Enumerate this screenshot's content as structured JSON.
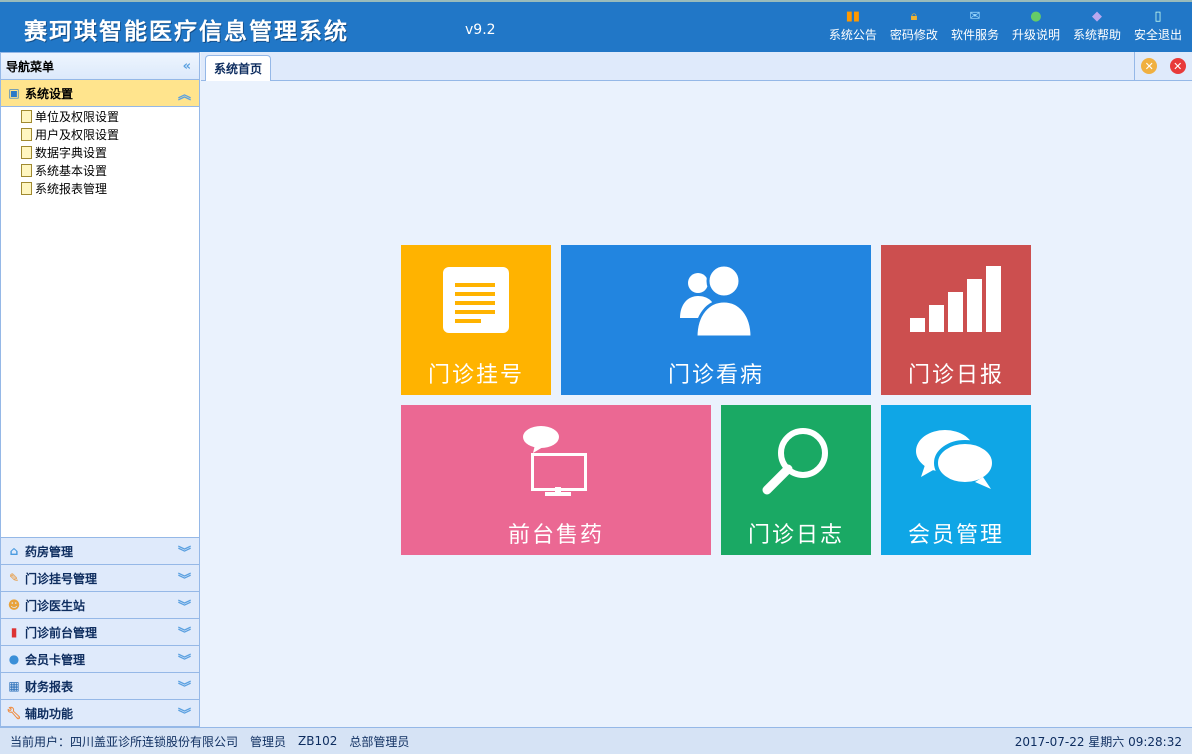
{
  "header": {
    "title": "赛珂琪智能医疗信息管理系统",
    "version": "v9.2",
    "tools": [
      {
        "label": "系统公告",
        "icon": "announcement-icon"
      },
      {
        "label": "密码修改",
        "icon": "lock-icon"
      },
      {
        "label": "软件服务",
        "icon": "mail-icon"
      },
      {
        "label": "升级说明",
        "icon": "globe-icon"
      },
      {
        "label": "系统帮助",
        "icon": "book-icon"
      },
      {
        "label": "安全退出",
        "icon": "exit-door-icon"
      }
    ]
  },
  "sidebar": {
    "title": "导航菜单",
    "active": {
      "label": "系统设置",
      "items": [
        "单位及权限设置",
        "用户及权限设置",
        "数据字典设置",
        "系统基本设置",
        "系统报表管理"
      ]
    },
    "sections": [
      "药房管理",
      "门诊挂号管理",
      "门诊医生站",
      "门诊前台管理",
      "会员卡管理",
      "财务报表",
      "辅助功能"
    ]
  },
  "tabs": {
    "active": "系统首页"
  },
  "tiles": [
    {
      "label": "门诊挂号",
      "color": "#ffb300"
    },
    {
      "label": "门诊看病",
      "color": "#2285e0"
    },
    {
      "label": "门诊日报",
      "color": "#cc4f4f"
    },
    {
      "label": "前台售药",
      "color": "#eb6893"
    },
    {
      "label": "门诊日志",
      "color": "#1aa964"
    },
    {
      "label": "会员管理",
      "color": "#0fa6e6"
    }
  ],
  "status": {
    "user_label": "当前用户：四川盖亚诊所连锁股份有限公司",
    "role": "管理员",
    "code": "ZB102",
    "dept": "总部管理员",
    "datetime": "2017-07-22 星期六 09:28:32"
  }
}
